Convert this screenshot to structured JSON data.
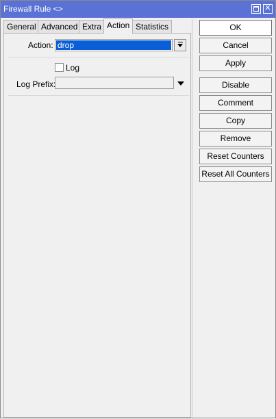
{
  "window": {
    "title": "Firewall Rule <>",
    "minimize_glyph": "",
    "close_glyph": "✕"
  },
  "tabs": [
    {
      "label": "General"
    },
    {
      "label": "Advanced"
    },
    {
      "label": "Extra"
    },
    {
      "label": "Action",
      "active": true
    },
    {
      "label": "Statistics"
    }
  ],
  "form": {
    "action_label": "Action:",
    "action_value": "drop",
    "log_label": "Log",
    "log_checked": false,
    "log_prefix_label": "Log Prefix:",
    "log_prefix_value": ""
  },
  "buttons": {
    "ok": "OK",
    "cancel": "Cancel",
    "apply": "Apply",
    "disable": "Disable",
    "comment": "Comment",
    "copy": "Copy",
    "remove": "Remove",
    "reset_counters": "Reset Counters",
    "reset_all_counters": "Reset All Counters"
  }
}
